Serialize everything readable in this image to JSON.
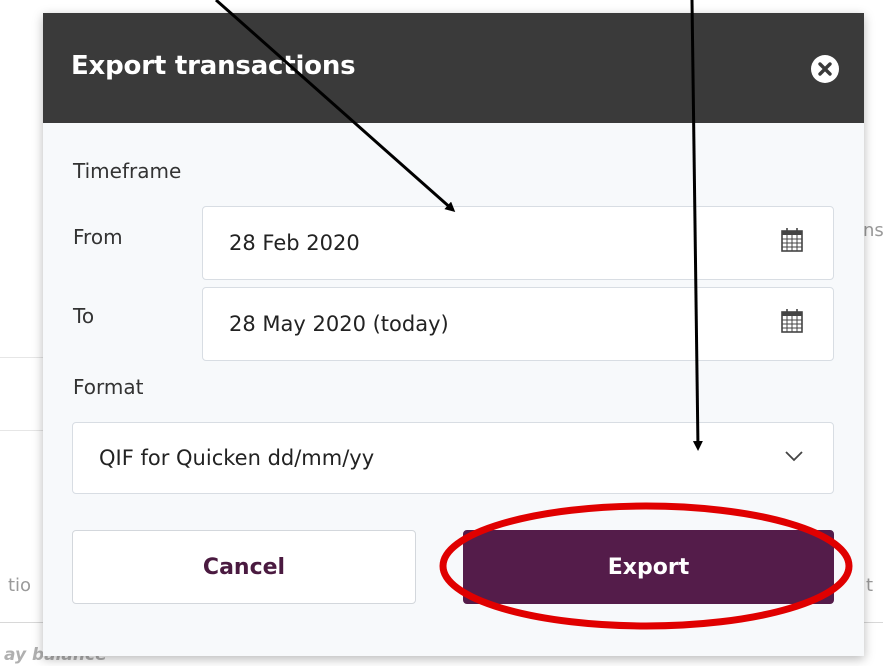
{
  "background": {
    "partial_text_right": "ns",
    "partial_text_left": "tio",
    "partial_text_far_right": "t",
    "footer_text": "ay balance"
  },
  "dialog": {
    "title": "Export transactions",
    "close_icon": "close-circle-icon",
    "timeframe_label": "Timeframe",
    "from": {
      "label": "From",
      "value": "28 Feb 2020",
      "icon": "calendar-icon"
    },
    "to": {
      "label": "To",
      "value": "28 May 2020 (today)",
      "icon": "calendar-icon"
    },
    "format": {
      "label": "Format",
      "value": "QIF for Quicken dd/mm/yy",
      "icon": "chevron-down-icon"
    },
    "cancel_label": "Cancel",
    "export_label": "Export"
  },
  "colors": {
    "header_bg": "#3a3a3a",
    "export_bg": "#541c4a",
    "annotation_circle": "#e00000",
    "annotation_arrow": "#000000"
  }
}
